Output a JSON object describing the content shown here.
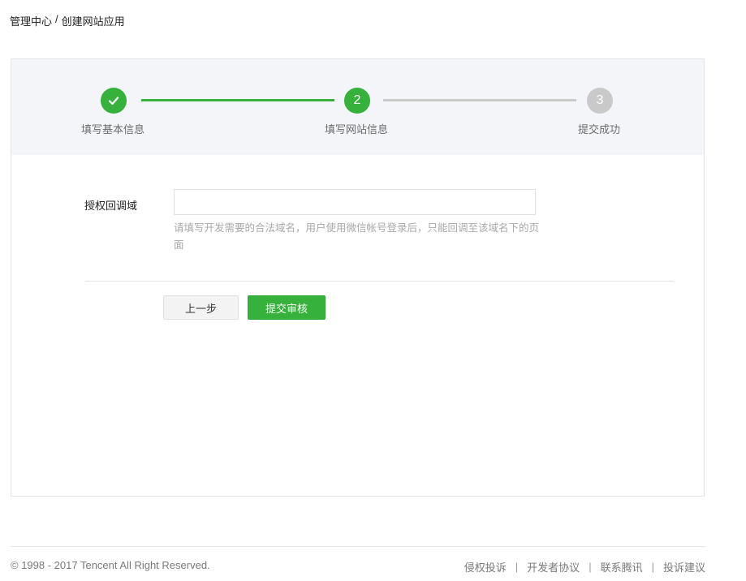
{
  "breadcrumb": {
    "root": "管理中心",
    "separator": "/",
    "current": "创建网站应用"
  },
  "steps": [
    {
      "label": "填写基本信息",
      "state": "done",
      "number": "",
      "icon": "check-icon"
    },
    {
      "label": "填写网站信息",
      "state": "active",
      "number": "2"
    },
    {
      "label": "提交成功",
      "state": "pending",
      "number": "3"
    }
  ],
  "form": {
    "callback_domain_label": "授权回调域",
    "callback_domain_value": "",
    "callback_domain_hint": "请填写开发需要的合法域名，用户使用微信帐号登录后，只能回调至该域名下的页面"
  },
  "buttons": {
    "prev": "上一步",
    "submit": "提交审核"
  },
  "footer": {
    "copyright": "© 1998 - 2017 Tencent All Right Reserved.",
    "separator": "|",
    "links": [
      "侵权投诉",
      "开发者协议",
      "联系腾讯",
      "投诉建议"
    ]
  },
  "colors": {
    "accent_green": "#36b13b",
    "pending_gray": "#c9c9c9",
    "steps_background": "#f4f5f9"
  }
}
